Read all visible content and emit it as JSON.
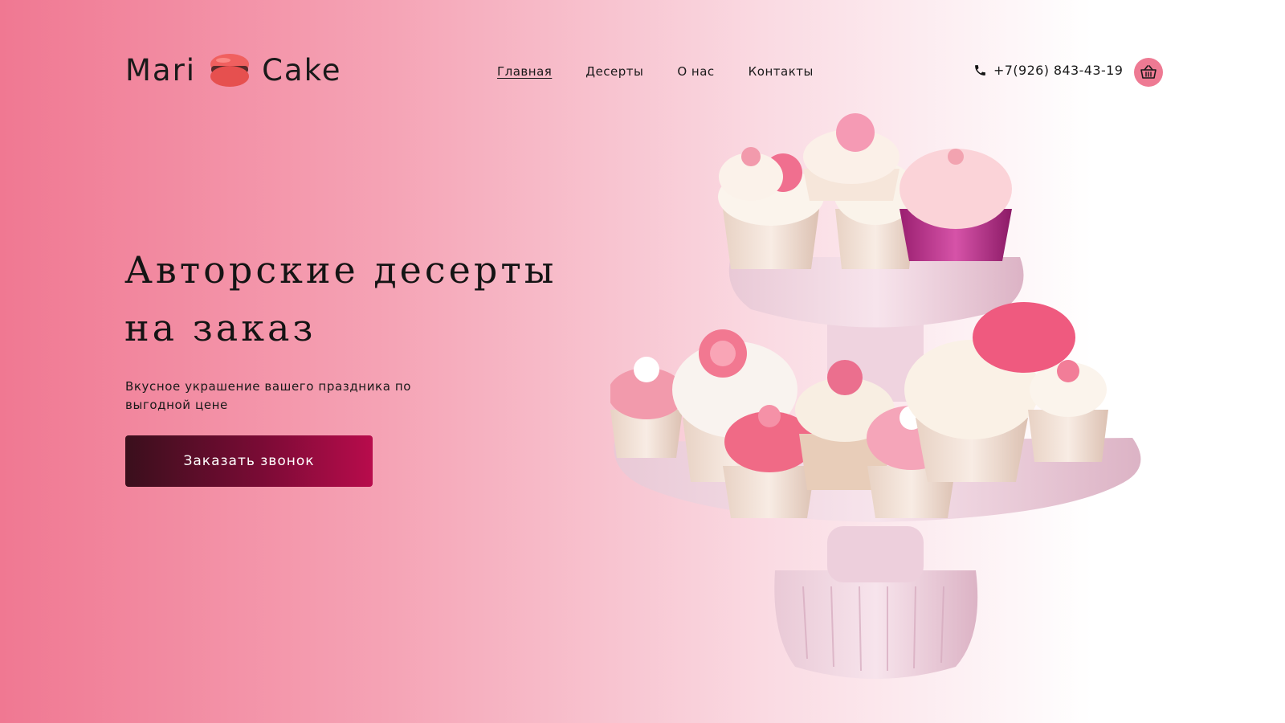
{
  "logo": {
    "left_text": "Mari",
    "right_text": "Cake",
    "icon": "macaron-icon"
  },
  "nav": {
    "items": [
      {
        "label": "Главная",
        "active": true
      },
      {
        "label": "Десерты",
        "active": false
      },
      {
        "label": "О нас",
        "active": false
      },
      {
        "label": "Контакты",
        "active": false
      }
    ]
  },
  "header": {
    "phone": "+7(926) 843-43-19",
    "phone_icon": "phone-icon",
    "cart_icon": "basket-icon"
  },
  "hero": {
    "title": "Авторские десерты на заказ",
    "subtitle": "Вкусное украшение вашего праздника по выгодной цене",
    "cta_label": "Заказать звонок",
    "image": "cupcake-stand-illustration"
  },
  "colors": {
    "accent_pink": "#ee7a93",
    "button_dark": "#3a0f1c",
    "button_light": "#b80c4c"
  }
}
